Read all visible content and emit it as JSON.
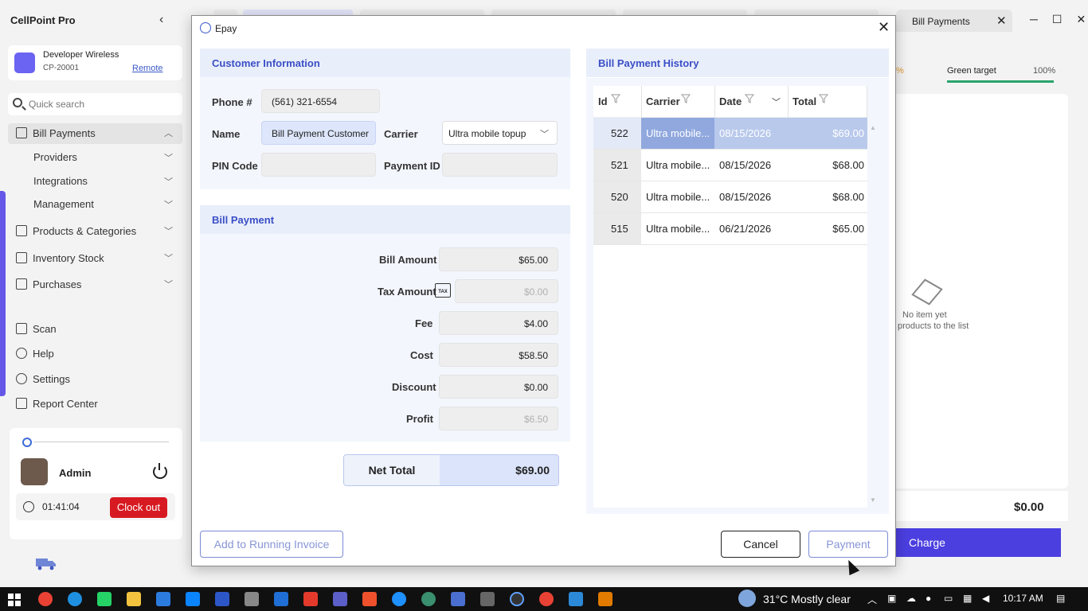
{
  "app": {
    "title": "CellPoint Pro",
    "collapse_icon": "chevron-left-icon"
  },
  "store": {
    "name": "Developer Wireless",
    "code": "CP-20001",
    "mode_link": "Remote"
  },
  "search": {
    "placeholder": "Quick search"
  },
  "sidebar": {
    "items": [
      {
        "label": "Bill Payments",
        "icon": "bill-icon",
        "expanded": true
      },
      {
        "label": "Providers"
      },
      {
        "label": "Integrations"
      },
      {
        "label": "Management"
      },
      {
        "label": "Products & Categories",
        "icon": "products-icon"
      },
      {
        "label": "Inventory Stock",
        "icon": "inventory-icon"
      },
      {
        "label": "Purchases",
        "icon": "purchases-icon"
      },
      {
        "label": "Scan",
        "icon": "scan-icon"
      },
      {
        "label": "Help",
        "icon": "help-icon"
      },
      {
        "label": "Settings",
        "icon": "settings-icon"
      },
      {
        "label": "Report Center",
        "icon": "report-icon"
      }
    ]
  },
  "user": {
    "name": "Admin",
    "timer": "01:41:04",
    "clock_out": "Clock out"
  },
  "background_app": {
    "tab_label": "Bill Payments",
    "target_label": "Green target",
    "target_value": "100%",
    "left_pct": "%",
    "empty_line1": "No item yet",
    "empty_line2": "products to the list",
    "total": "$0.00",
    "charge_label": "Charge"
  },
  "dialog": {
    "title": "Epay",
    "customer": {
      "heading": "Customer Information",
      "phone_label": "Phone #",
      "phone_value": "(561) 321-6554",
      "name_label": "Name",
      "name_value": "Bill Payment Customer",
      "carrier_label": "Carrier",
      "carrier_value": "Ultra mobile topup",
      "pin_label": "PIN Code",
      "pin_value": "",
      "payment_id_label": "Payment ID",
      "payment_id_value": ""
    },
    "bill": {
      "heading": "Bill Payment",
      "rows": [
        {
          "label": "Bill Amount",
          "value": "$65.00"
        },
        {
          "label": "Tax Amount",
          "value": "$0.00"
        },
        {
          "label": "Fee",
          "value": "$4.00"
        },
        {
          "label": "Cost",
          "value": "$58.50"
        },
        {
          "label": "Discount",
          "value": "$0.00"
        },
        {
          "label": "Profit",
          "value": "$6.50"
        }
      ],
      "tax_icon_text": "TAX",
      "net_total_label": "Net Total",
      "net_total_value": "$69.00"
    },
    "history": {
      "heading": "Bill Payment History",
      "columns": [
        "Id",
        "Carrier",
        "Date",
        "Total"
      ],
      "rows": [
        {
          "id": "522",
          "carrier": "Ultra mobile...",
          "date": "08/15/2026",
          "total": "$69.00"
        },
        {
          "id": "521",
          "carrier": "Ultra mobile...",
          "date": "08/15/2026",
          "total": "$68.00"
        },
        {
          "id": "520",
          "carrier": "Ultra mobile...",
          "date": "08/15/2026",
          "total": "$68.00"
        },
        {
          "id": "515",
          "carrier": "Ultra mobile...",
          "date": "06/21/2026",
          "total": "$65.00"
        }
      ]
    },
    "buttons": {
      "add_to_invoice": "Add to Running Invoice",
      "cancel": "Cancel",
      "payment": "Payment"
    }
  },
  "taskbar": {
    "weather": "31°C  Mostly clear",
    "time": "10:17 AM"
  }
}
